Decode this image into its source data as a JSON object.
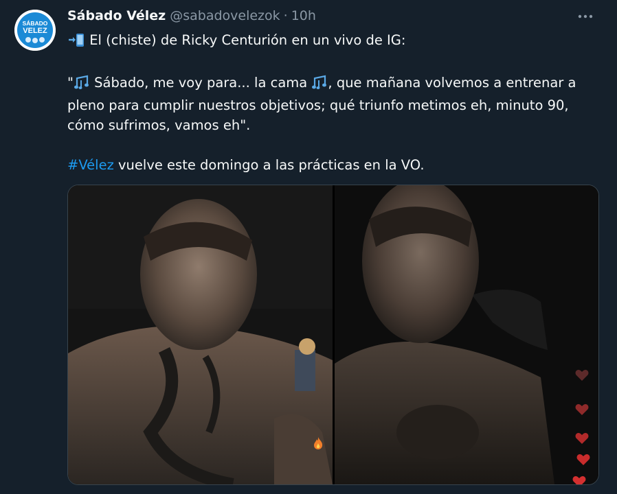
{
  "account": {
    "avatar_text_top": "SÁBADO",
    "avatar_text_bottom": "VELEZ",
    "name": "Sábado Vélez",
    "handle": "@sabadovelezok",
    "separator": "·",
    "time": "10h"
  },
  "tweet": {
    "line1": "El (chiste) de Ricky Centurión en un vivo de IG:",
    "quote_open": "\"",
    "quote_part1": " Sábado, me voy para... la cama ",
    "quote_part2": ", que mañana volvemos a entrenar a pleno para cumplir nuestros objetivos; qué triunfo metimos eh, minuto 90, cómo sufrimos, vamos eh\".",
    "hashtag": "#Vélez",
    "hashtag_rest": " vuelve este domingo a las prácticas en la VO."
  },
  "icons": {
    "more": "more-horizontal-icon",
    "lead": "phone-arrow-icon",
    "notes": "music-notes-icon",
    "fire": "fire-icon",
    "heart": "heart-icon"
  },
  "colors": {
    "background": "#15202b",
    "text": "#f7f9f9",
    "muted": "#8b98a5",
    "link": "#1d9bf0",
    "avatar_blue": "#1b8ad6"
  }
}
